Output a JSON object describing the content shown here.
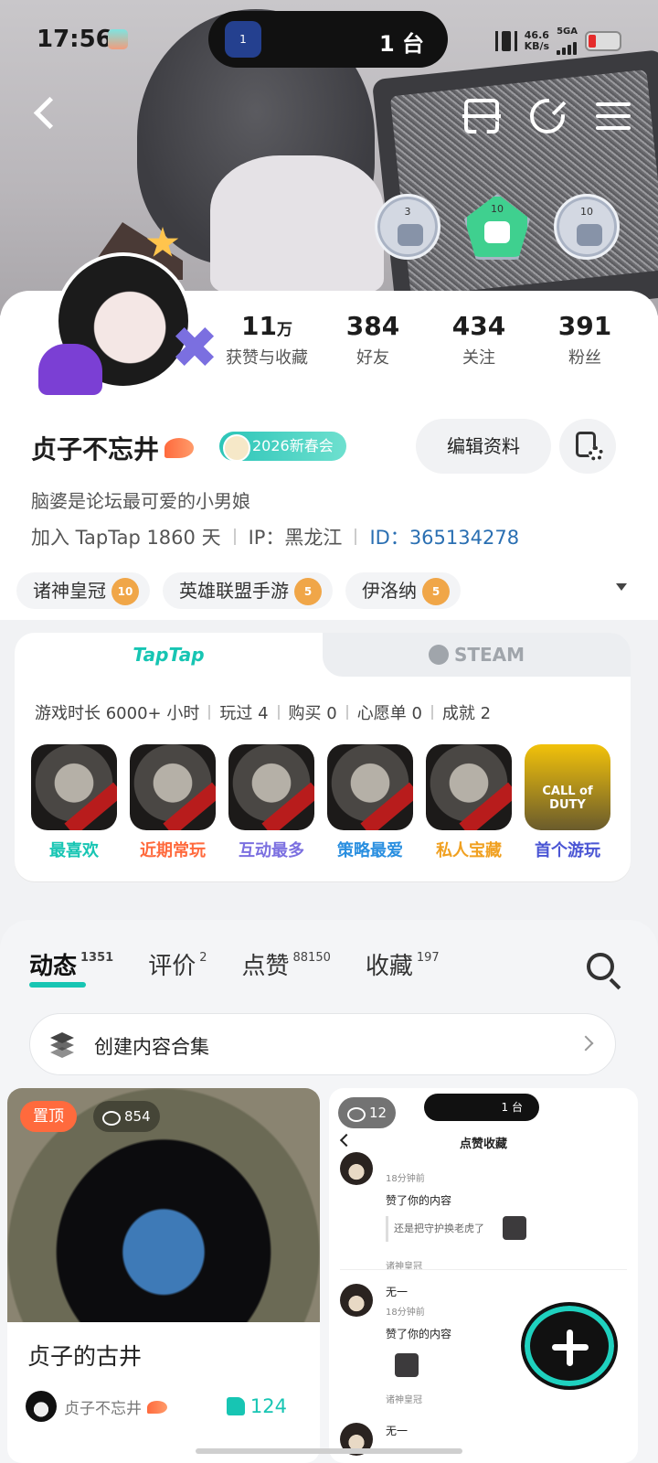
{
  "status_bar": {
    "time": "17:56",
    "island_text": "1 台",
    "island_badge": "1",
    "net_speed_value": "46.6",
    "net_speed_unit": "KB/s",
    "network": "5GA"
  },
  "banner": {
    "badges": [
      {
        "num": "3",
        "icon": "thumb-badge-icon"
      },
      {
        "num": "10",
        "icon": "thumb-badge-icon"
      },
      {
        "num": "10",
        "icon": "gamepad-badge-icon"
      }
    ]
  },
  "profile": {
    "stats": [
      {
        "value": "11",
        "unit": "万",
        "label": "获赞与收藏"
      },
      {
        "value": "384",
        "unit": "",
        "label": "好友"
      },
      {
        "value": "434",
        "unit": "",
        "label": "关注"
      },
      {
        "value": "391",
        "unit": "",
        "label": "粉丝"
      }
    ],
    "nickname": "贞子不忘井",
    "event_badge": "2026新春会",
    "edit_label": "编辑资料",
    "bio": "脑婆是论坛最可爱的小男娘",
    "joined": "加入 TapTap 1860 天",
    "ip": "IP：黑龙江",
    "id_prefix": "ID：",
    "id_value": "365134278",
    "games": [
      {
        "name": "诸神皇冠",
        "level": "10"
      },
      {
        "name": "英雄联盟手游",
        "level": "5"
      },
      {
        "name": "伊洛纳",
        "level": "5"
      }
    ]
  },
  "platform": {
    "tabs": [
      "TapTap",
      "STEAM"
    ],
    "stats": [
      "游戏时长 6000+ 小时",
      "玩过 4",
      "购买 0",
      "心愿单 0",
      "成就 2"
    ],
    "tiles": [
      {
        "label": "最喜欢",
        "color": "#17c5b3",
        "art": ""
      },
      {
        "label": "近期常玩",
        "color": "#ff6a3d",
        "art": ""
      },
      {
        "label": "互动最多",
        "color": "#7b6fe0",
        "art": ""
      },
      {
        "label": "策略最爱",
        "color": "#2a8fe0",
        "art": ""
      },
      {
        "label": "私人宝藏",
        "color": "#f0a020",
        "art": ""
      },
      {
        "label": "首个游玩",
        "color": "#4a55d4",
        "art": "CALL of DUTY"
      }
    ]
  },
  "content": {
    "tabs": [
      {
        "label": "动态",
        "count": "1351"
      },
      {
        "label": "评价",
        "count": "2"
      },
      {
        "label": "点赞",
        "count": "88150"
      },
      {
        "label": "收藏",
        "count": "197"
      }
    ],
    "collection_label": "创建内容合集"
  },
  "feed": {
    "left": {
      "pin_label": "置顶",
      "views": "854",
      "title": "贞子的古井",
      "author": "贞子不忘井",
      "likes": "124"
    },
    "right": {
      "views": "12",
      "island_text": "1 台",
      "title": "点赞收藏",
      "items": [
        {
          "name": "",
          "time": "18分钟前",
          "action": "赞了你的内容",
          "quote": "还是把守护换老虎了",
          "game": "诸神皇冠"
        },
        {
          "name": "无一",
          "time": "18分钟前",
          "action": "赞了你的内容",
          "quote": "",
          "game": "诸神皇冠"
        }
      ],
      "next_name": "无一"
    }
  }
}
